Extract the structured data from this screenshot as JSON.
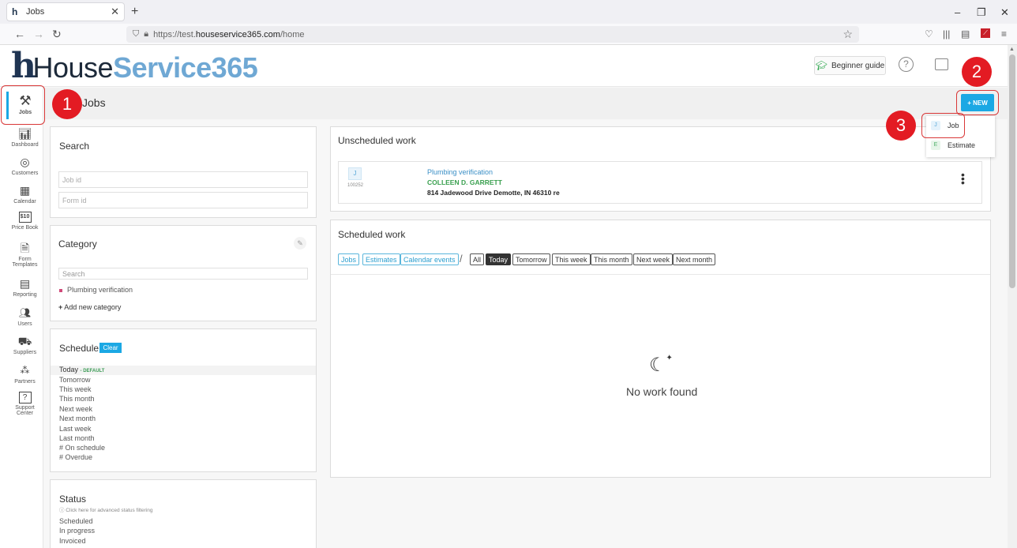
{
  "browser": {
    "tab_title": "Jobs",
    "url_prefix": "https://test.",
    "url_domain": "houseservice365.com",
    "url_path": "/home"
  },
  "header": {
    "logo_part1": "House",
    "logo_part2": "Service365",
    "beginner_guide": "Beginner guide",
    "help": "?"
  },
  "sidebar": {
    "items": [
      {
        "label": "Jobs",
        "icon": "tools-icon"
      },
      {
        "label": "Dashboard",
        "icon": "chart-icon"
      },
      {
        "label": "Customers",
        "icon": "target-icon"
      },
      {
        "label": "Calendar",
        "icon": "calendar-icon"
      },
      {
        "label": "Price Book",
        "icon": "price-icon"
      },
      {
        "label": "Form Templates",
        "icon": "form-icon"
      },
      {
        "label": "Reporting",
        "icon": "report-icon"
      },
      {
        "label": "Users",
        "icon": "users-icon"
      },
      {
        "label": "Suppliers",
        "icon": "truck-icon"
      },
      {
        "label": "Partners",
        "icon": "partners-icon"
      },
      {
        "label": "Support Center",
        "icon": "support-icon"
      }
    ],
    "price_badge": "$10"
  },
  "page": {
    "title": "Jobs",
    "new_button": "+ NEW"
  },
  "new_menu": {
    "items": [
      {
        "tag": "J",
        "label": "Job"
      },
      {
        "tag": "E",
        "label": "Estimate"
      }
    ]
  },
  "annotations": [
    "1",
    "2",
    "3"
  ],
  "search_panel": {
    "title": "Search",
    "job_id_placeholder": "Job id",
    "form_id_placeholder": "Form id"
  },
  "category_panel": {
    "title": "Category",
    "search_placeholder": "Search",
    "items": [
      "Plumbing verification"
    ],
    "add_new": "Add new category"
  },
  "schedule_panel": {
    "title": "Schedule",
    "clear": "Clear",
    "default_tag": "- DEFAULT",
    "items": [
      "Today",
      "Tomorrow",
      "This week",
      "This month",
      "Next week",
      "Next month",
      "Last week",
      "Last month",
      "# On schedule",
      "# Overdue"
    ]
  },
  "status_panel": {
    "title": "Status",
    "hint": "ⓘ Click here for advanced status filtering",
    "items": [
      "Scheduled",
      "In progress",
      "Invoiced"
    ]
  },
  "unscheduled": {
    "title": "Unscheduled work",
    "job": {
      "tag": "J",
      "id": "100252",
      "title": "Plumbing verification",
      "customer": "COLLEEN D. GARRETT",
      "address": "814 Jadewood Drive Demotte, IN 46310 re"
    }
  },
  "scheduled": {
    "title": "Scheduled work",
    "type_filters": [
      "Jobs",
      "Estimates",
      "Calendar events"
    ],
    "separator": "/",
    "range_filters": [
      "All",
      "Today",
      "Tomorrow",
      "This week",
      "This month",
      "Next week",
      "Next month"
    ],
    "active_range": "Today",
    "empty_text": "No work found"
  }
}
